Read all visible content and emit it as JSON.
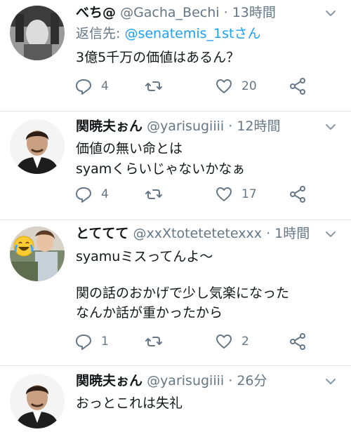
{
  "tweets": [
    {
      "name": "べち@",
      "handle": "@Gacha_Bechi",
      "time": "13時間",
      "reply_prefix": "返信先: ",
      "reply_to": "@senatemis_1stさん",
      "lines": [
        "3億5千万の価値はあるん？"
      ],
      "replies": "4",
      "retweets": "",
      "likes": "20"
    },
    {
      "name": "関暁夫ぉん",
      "handle": "@yarisugiiii",
      "time": "12時間",
      "lines": [
        "価値の無い命とは",
        "syamくらいじゃないかなぁ"
      ],
      "replies": "4",
      "retweets": "",
      "likes": "17"
    },
    {
      "name": "とててて",
      "handle": "@xxXtotetetetexxx",
      "time": "1時間",
      "lines": [
        "syamuミスってんよ〜",
        "",
        "関の話のおかげで少し気楽になった",
        "なんか話が重かったから"
      ],
      "replies": "1",
      "retweets": "",
      "likes": "2"
    },
    {
      "name": "関暁夫ぉん",
      "handle": "@yarisugiiii",
      "time": "26分",
      "lines": [
        "おっとこれは失礼"
      ]
    }
  ],
  "separator": "·",
  "icons": [
    "reply-icon",
    "retweet-icon",
    "like-icon",
    "share-icon",
    "chevron-down-icon"
  ],
  "colors": {
    "link": "#1da1f2",
    "muted": "#657786",
    "text": "#14171a",
    "divider": "#e1e8ed"
  }
}
